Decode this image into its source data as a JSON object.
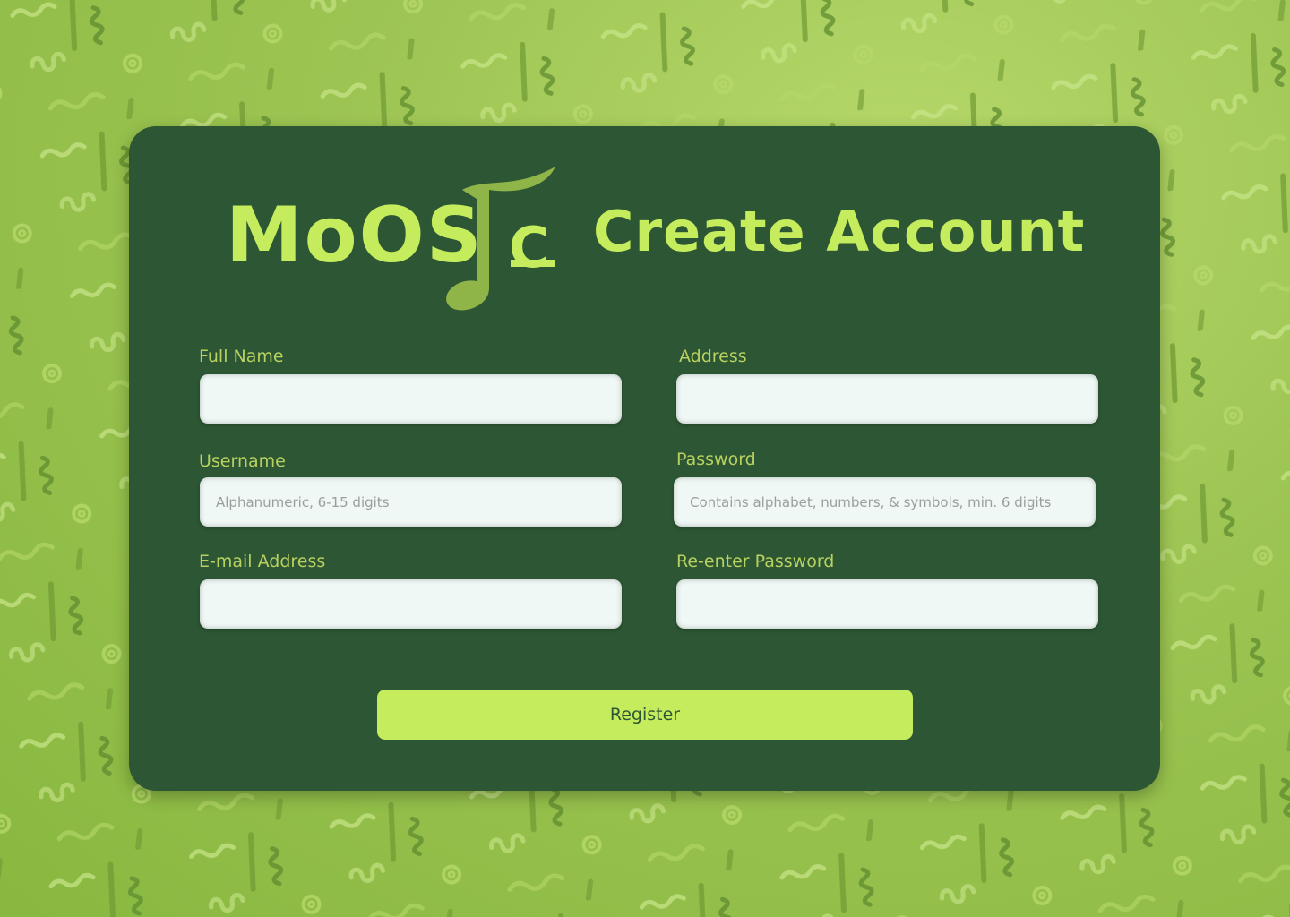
{
  "logo": {
    "text": "MoOS",
    "tail": "C",
    "icon": "music-note-icon"
  },
  "title": "Create Account",
  "form": {
    "full_name": {
      "label": "Full Name",
      "value": "",
      "placeholder": ""
    },
    "address": {
      "label": "Address",
      "value": "",
      "placeholder": ""
    },
    "username": {
      "label": "Username",
      "value": "",
      "placeholder": "Alphanumeric, 6-15 digits"
    },
    "password": {
      "label": "Password",
      "value": "",
      "placeholder": "Contains alphabet, numbers, & symbols, min. 6 digits"
    },
    "email": {
      "label": "E-mail Address",
      "value": "",
      "placeholder": ""
    },
    "reenter_password": {
      "label": "Re-enter Password",
      "value": "",
      "placeholder": ""
    }
  },
  "register_label": "Register",
  "colors": {
    "background": "#9cc452",
    "card": "#2d5734",
    "accent": "#c5ec5c",
    "label": "#b8d160",
    "input_bg": "#eff8f5"
  }
}
